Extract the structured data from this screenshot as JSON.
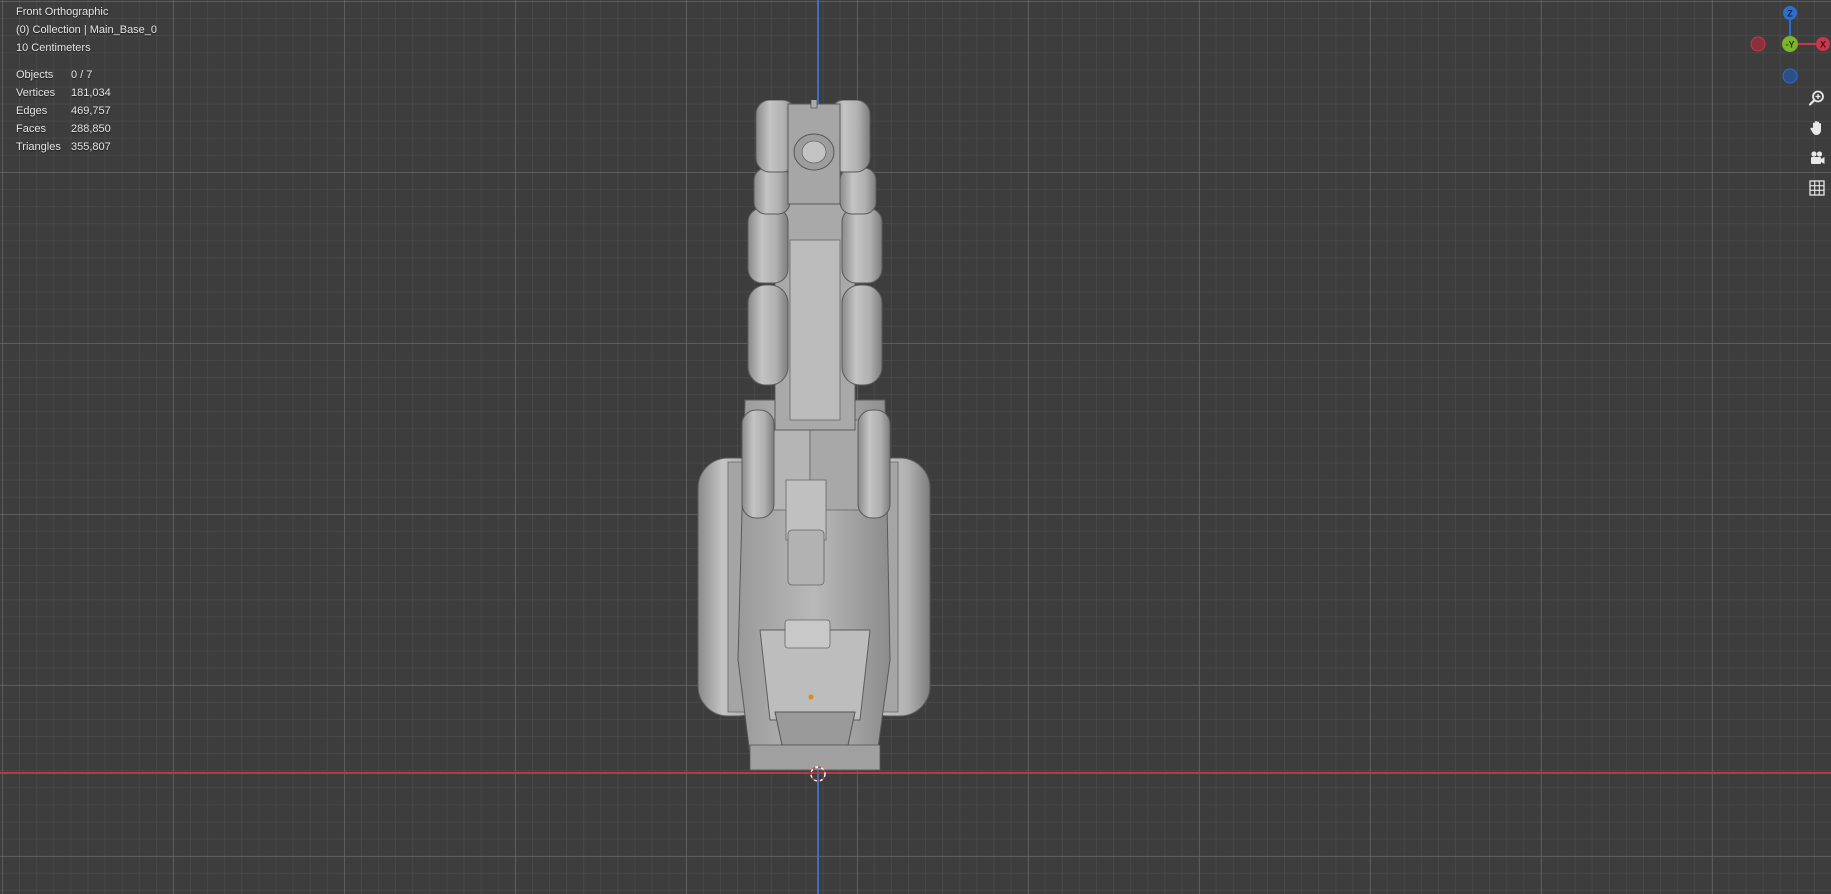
{
  "viewport": {
    "view_name": "Front Orthographic",
    "collection": "(0) Collection | Main_Base_0",
    "scale": "10 Centimeters"
  },
  "stats": [
    {
      "label": "Objects",
      "value": "0 / 7"
    },
    {
      "label": "Vertices",
      "value": "181,034"
    },
    {
      "label": "Edges",
      "value": "469,757"
    },
    {
      "label": "Faces",
      "value": "288,850"
    },
    {
      "label": "Triangles",
      "value": "355,807"
    }
  ],
  "gizmo": {
    "z_label": "Z",
    "y_label": "-Y",
    "x_label": "X",
    "colors": {
      "x": "#c9374a",
      "y": "#7ab52a",
      "z": "#2c6fd1"
    }
  },
  "nav_icons": [
    "zoom-icon",
    "pan-hand-icon",
    "camera-icon",
    "grid-icon"
  ]
}
